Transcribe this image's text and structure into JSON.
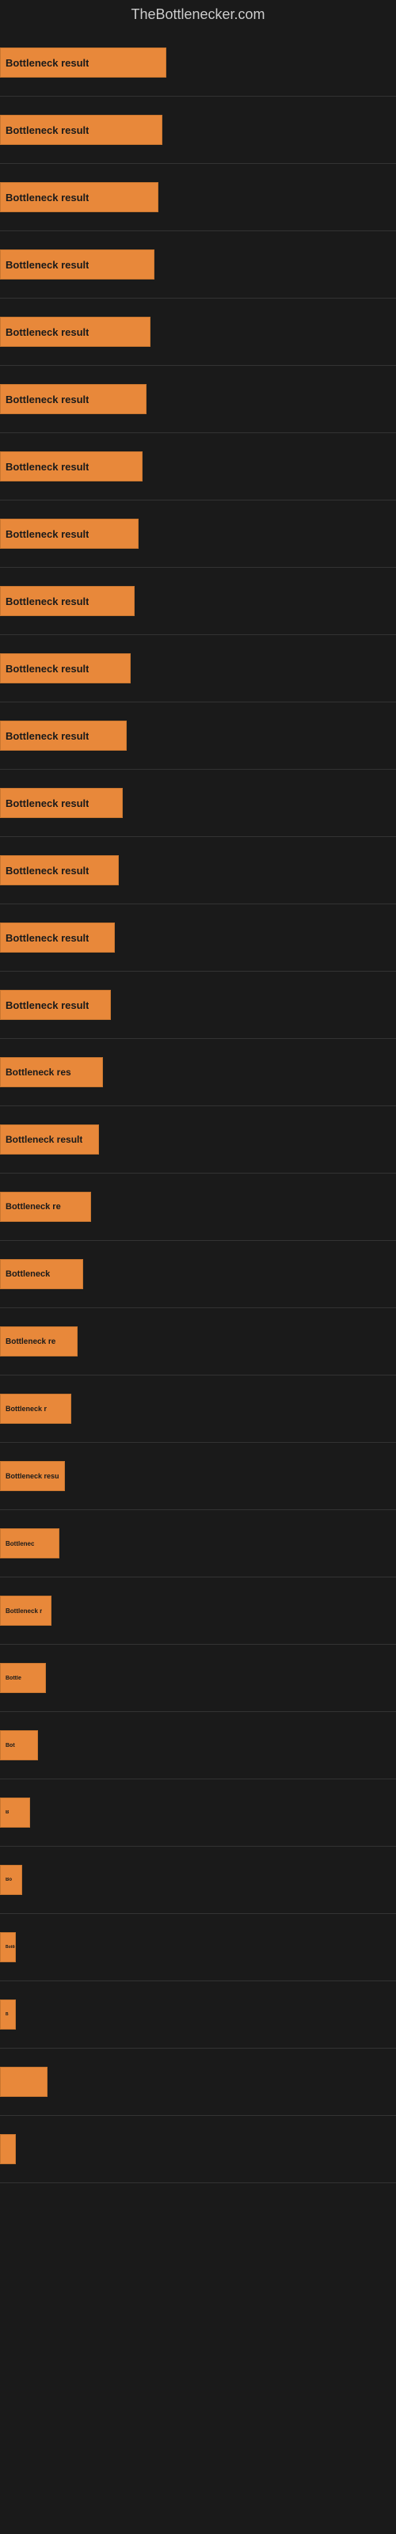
{
  "site": {
    "title": "TheBottlenecker.com"
  },
  "bars": [
    {
      "label": "Bottleneck result",
      "row": 1
    },
    {
      "label": "Bottleneck result",
      "row": 2
    },
    {
      "label": "Bottleneck result",
      "row": 3
    },
    {
      "label": "Bottleneck result",
      "row": 4
    },
    {
      "label": "Bottleneck result",
      "row": 5
    },
    {
      "label": "Bottleneck result",
      "row": 6
    },
    {
      "label": "Bottleneck result",
      "row": 7
    },
    {
      "label": "Bottleneck result",
      "row": 8
    },
    {
      "label": "Bottleneck result",
      "row": 9
    },
    {
      "label": "Bottleneck result",
      "row": 10
    },
    {
      "label": "Bottleneck result",
      "row": 11
    },
    {
      "label": "Bottleneck result",
      "row": 12
    },
    {
      "label": "Bottleneck result",
      "row": 13
    },
    {
      "label": "Bottleneck result",
      "row": 14
    },
    {
      "label": "Bottleneck result",
      "row": 15
    },
    {
      "label": "Bottleneck res",
      "row": 16
    },
    {
      "label": "Bottleneck result",
      "row": 17
    },
    {
      "label": "Bottleneck re",
      "row": 18
    },
    {
      "label": "Bottleneck",
      "row": 19
    },
    {
      "label": "Bottleneck re",
      "row": 20
    },
    {
      "label": "Bottleneck r",
      "row": 21
    },
    {
      "label": "Bottleneck resu",
      "row": 22
    },
    {
      "label": "Bottlenec",
      "row": 23
    },
    {
      "label": "Bottleneck r",
      "row": 24
    },
    {
      "label": "Bottle",
      "row": 25
    },
    {
      "label": "Bot",
      "row": 26
    },
    {
      "label": "B",
      "row": 27
    },
    {
      "label": "Bo",
      "row": 28
    },
    {
      "label": "Bottle",
      "row": 29
    },
    {
      "label": "B",
      "row": 30
    },
    {
      "label": "",
      "row": 31
    },
    {
      "label": "",
      "row": 32
    }
  ]
}
